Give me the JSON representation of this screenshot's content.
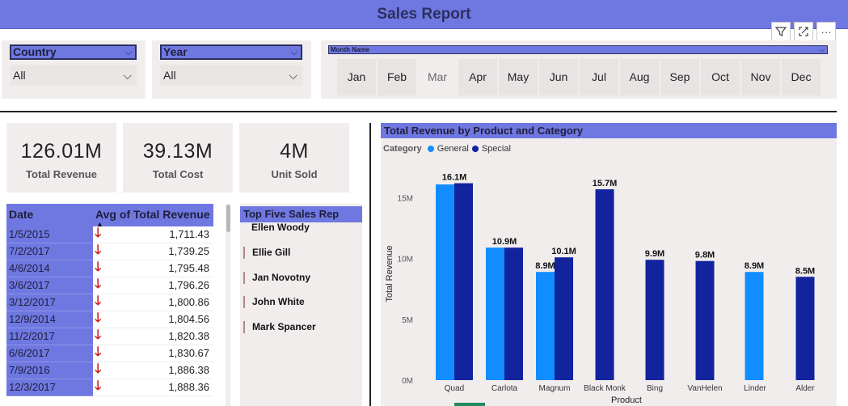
{
  "title": "Sales Report",
  "toolbar": {
    "filter_icon": "funnel-icon",
    "focus_icon": "expand-icon",
    "more_icon": "ellipsis-icon",
    "more_glyph": "···"
  },
  "slicers": {
    "country": {
      "label": "Country",
      "value": "All"
    },
    "year": {
      "label": "Year",
      "value": "All"
    },
    "month": {
      "label": "Month Name",
      "options": [
        "Jan",
        "Feb",
        "Mar",
        "Apr",
        "May",
        "Jun",
        "Jul",
        "Aug",
        "Sep",
        "Oct",
        "Nov",
        "Dec"
      ]
    }
  },
  "kpis": [
    {
      "value": "126.01M",
      "label": "Total Revenue"
    },
    {
      "value": "39.13M",
      "label": "Total Cost"
    },
    {
      "value": "4M",
      "label": "Unit Sold"
    }
  ],
  "table": {
    "headers": [
      "Date",
      "Avg of Total Revenue"
    ],
    "rows": [
      [
        "1/5/2015",
        "1,711.43"
      ],
      [
        "7/2/2017",
        "1,739.25"
      ],
      [
        "4/6/2014",
        "1,795.48"
      ],
      [
        "3/6/2017",
        "1,796.26"
      ],
      [
        "3/12/2017",
        "1,800.86"
      ],
      [
        "12/9/2014",
        "1,804.56"
      ],
      [
        "11/2/2017",
        "1,820.38"
      ],
      [
        "6/6/2017",
        "1,830.67"
      ],
      [
        "7/9/2016",
        "1,886.38"
      ],
      [
        "12/3/2017",
        "1,888.36"
      ]
    ]
  },
  "top_reps": {
    "title": "Top Five Sales Rep",
    "names": [
      "Ellen Woody",
      "Ellie Gill",
      "Jan Novotny",
      "John White",
      "Mark Spancer"
    ]
  },
  "chart_data": {
    "type": "bar",
    "title": "Total Revenue by Product and Category",
    "legend_title": "Category",
    "legend_position": "top-left",
    "xlabel": "Product",
    "ylabel": "Total Revenue",
    "ylim": [
      0,
      17500000
    ],
    "yticks": [
      0,
      5000000,
      10000000,
      15000000
    ],
    "ytick_labels": [
      "0M",
      "5M",
      "10M",
      "15M"
    ],
    "categories": [
      "Quad",
      "Carlota",
      "Magnum",
      "Black Monk",
      "Bing",
      "VanHelen",
      "Linder",
      "Alder"
    ],
    "series": [
      {
        "name": "General",
        "color": "#118dff",
        "values": [
          16100000,
          10900000,
          8900000,
          null,
          null,
          null,
          8900000,
          null
        ]
      },
      {
        "name": "Special",
        "color": "#12239e",
        "values": [
          16200000,
          10900000,
          10100000,
          15700000,
          9900000,
          9800000,
          null,
          8500000
        ]
      }
    ],
    "data_labels": [
      "16.1M",
      "10.9M",
      "8.9M",
      "10.1M",
      "15.7M",
      "9.9M",
      "9.8M",
      "8.9M",
      "8.5M"
    ]
  }
}
